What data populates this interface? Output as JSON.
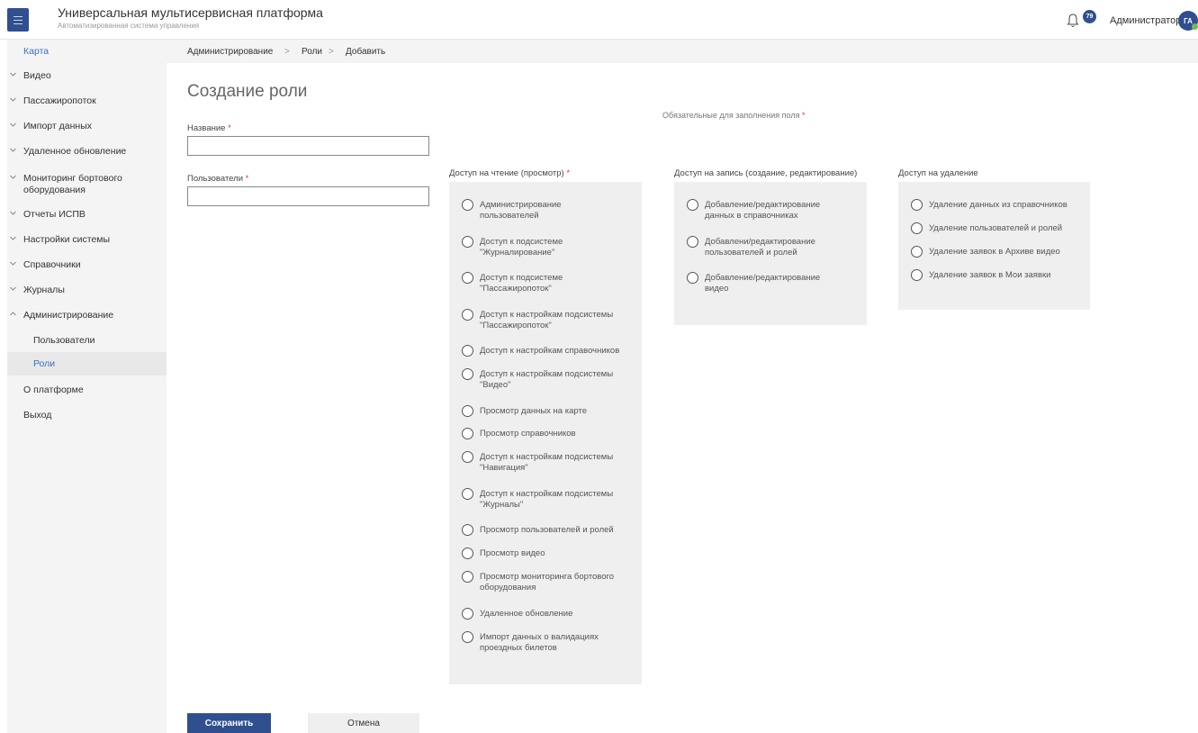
{
  "header": {
    "title": "Универсальная мультисервисная платформа",
    "subtitle": "Автоматизированная система управления",
    "notification_count": "79",
    "user_name": "Администратор",
    "avatar_initials": "ГА"
  },
  "sidebar": {
    "items": [
      {
        "label": "Карта",
        "type": "link"
      },
      {
        "label": "Видео",
        "type": "collapsed"
      },
      {
        "label": "Пассажиропоток",
        "type": "collapsed"
      },
      {
        "label": "Импорт данных",
        "type": "collapsed"
      },
      {
        "label": "Удаленное обновление",
        "type": "collapsed"
      },
      {
        "label": "Мониторинг бортового оборудования",
        "type": "collapsed"
      },
      {
        "label": "Отчеты ИСПВ",
        "type": "collapsed"
      },
      {
        "label": "Настройки системы",
        "type": "collapsed"
      },
      {
        "label": "Справочники",
        "type": "collapsed"
      },
      {
        "label": "Журналы",
        "type": "collapsed"
      },
      {
        "label": "Администрирование",
        "type": "expanded"
      },
      {
        "label": "Пользователи",
        "type": "sub"
      },
      {
        "label": "Роли",
        "type": "sub-active"
      },
      {
        "label": "О платформе",
        "type": "plain"
      },
      {
        "label": "Выход",
        "type": "plain"
      }
    ]
  },
  "breadcrumb": {
    "items": [
      "Администрирование",
      "Роли",
      "Добавить"
    ],
    "separator": ">"
  },
  "page": {
    "title": "Создание роли",
    "required_note": "Обязательные для заполнения поля",
    "required_mark": "*"
  },
  "form": {
    "name_label": "Название",
    "name_value": "",
    "users_label": "Пользователи",
    "users_value": ""
  },
  "permissions": {
    "read": {
      "title": "Доступ на чтение (просмотр)",
      "required": true,
      "options": [
        [
          "Администрирование",
          "пользователей"
        ],
        [
          "Доступ к подсистеме",
          "\"Журналирование\""
        ],
        [
          "Доступ к подсистеме",
          "\"Пассажиропоток\""
        ],
        [
          "Доступ к настройкам подсистемы",
          "\"Пассажиропоток\""
        ],
        [
          "Доступ к настройкам справочников"
        ],
        [
          "Доступ к настройкам подсистемы",
          "\"Видео\""
        ],
        [
          "Просмотр данных на карте"
        ],
        [
          "Просмотр справочников"
        ],
        [
          "Доступ к настройкам подсистемы",
          "\"Навигация\""
        ],
        [
          "Доступ к настройкам подсистемы",
          "\"Журналы\""
        ],
        [
          "Просмотр пользователей и ролей"
        ],
        [
          "Просмотр видео"
        ],
        [
          "Просмотр мониторинга бортового",
          "оборудования"
        ],
        [
          "Удаленное обновление"
        ],
        [
          "Импорт данных о валидациях",
          "проездных билетов"
        ]
      ]
    },
    "write": {
      "title": "Доступ на запись (создание, редактирование)",
      "required": false,
      "options": [
        [
          "Добавление/редактирование",
          "данных в справочниках"
        ],
        [
          "Добавлени/редактирование",
          "пользователей и ролей"
        ],
        [
          "Добавление/редактирование",
          "видео"
        ]
      ]
    },
    "delete": {
      "title": "Доступ на удаление",
      "required": false,
      "options": [
        [
          "Удаление данных из справочников"
        ],
        [
          "Удаление пользователей и ролей"
        ],
        [
          "Удаление заявок в Архиве видео"
        ],
        [
          "Удаление заявок в Мои заявки"
        ]
      ]
    }
  },
  "actions": {
    "save_label": "Сохранить",
    "cancel_label": "Отмена"
  },
  "colors": {
    "primary": "#2f4f8f",
    "link": "#3a6fc4",
    "required": "#d83b3b",
    "panel": "#efefef"
  }
}
